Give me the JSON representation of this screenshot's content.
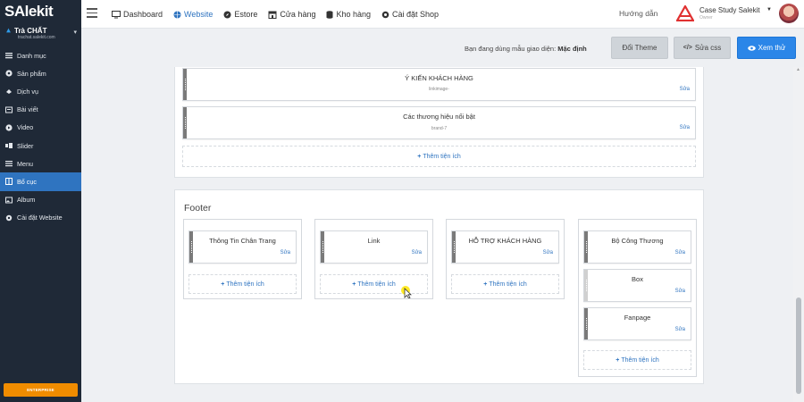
{
  "sidebar": {
    "logo": "SAlekit",
    "store_name": "Trà CHẤT",
    "store_url": "trachat.salekit.com",
    "items": [
      {
        "label": "Danh mục",
        "icon": "list-icon"
      },
      {
        "label": "Sản phẩm",
        "icon": "tag-icon"
      },
      {
        "label": "Dịch vụ",
        "icon": "service-icon"
      },
      {
        "label": "Bài viết",
        "icon": "article-icon"
      },
      {
        "label": "Video",
        "icon": "video-icon"
      },
      {
        "label": "Slider",
        "icon": "slider-icon"
      },
      {
        "label": "Menu",
        "icon": "menu-icon"
      },
      {
        "label": "Bố cục",
        "icon": "layout-icon",
        "active": true
      },
      {
        "label": "Album",
        "icon": "album-icon"
      },
      {
        "label": "Cài đặt Website",
        "icon": "gear-icon"
      }
    ],
    "enterprise_label": "ENTERPRISE"
  },
  "topbar": {
    "nav": [
      {
        "label": "Dashboard",
        "icon": "monitor-icon"
      },
      {
        "label": "Website",
        "icon": "globe-icon",
        "active": true
      },
      {
        "label": "Estore",
        "icon": "compass-icon"
      },
      {
        "label": "Cửa hàng",
        "icon": "store-icon"
      },
      {
        "label": "Kho hàng",
        "icon": "database-icon"
      },
      {
        "label": "Cài đặt Shop",
        "icon": "gear-icon"
      }
    ],
    "help": "Hướng dẫn",
    "user_name": "Case Study Salekit",
    "user_role": "Owner"
  },
  "themebar": {
    "text": "Bạn đang dùng mẫu giao diện:",
    "theme_name": "Mặc định",
    "change_theme": "Đổi Theme",
    "edit_css": "Sửa css",
    "preview": "Xem thử"
  },
  "content_section": {
    "widgets": [
      {
        "title": "Ý KIẾN KHÁCH HÀNG",
        "sub": "linkimage-",
        "edit": "Sửa"
      },
      {
        "title": "Các thương hiệu nổi bật",
        "sub": "brand-7",
        "edit": "Sửa"
      }
    ],
    "add_label": "Thêm tiện ích"
  },
  "footer": {
    "title": "Footer",
    "columns": [
      {
        "widgets": [
          {
            "title": "Thông Tin Chân Trang",
            "edit": "Sửa"
          }
        ],
        "add_label": "Thêm tiện ích"
      },
      {
        "widgets": [
          {
            "title": "Link",
            "edit": "Sửa"
          }
        ],
        "add_label": "Thêm tiện ích"
      },
      {
        "widgets": [
          {
            "title": "HỖ TRỢ KHÁCH HÀNG",
            "edit": "Sửa"
          }
        ],
        "add_label": "Thêm tiện ích"
      },
      {
        "widgets": [
          {
            "title": "Bộ Công Thương",
            "edit": "Sửa"
          },
          {
            "title": "Box",
            "edit": "Sửa"
          },
          {
            "title": "Fanpage",
            "edit": "Sửa"
          }
        ],
        "add_label": "Thêm tiện ích"
      }
    ]
  },
  "colors": {
    "sidebar_bg": "#1f2937",
    "active_blue": "#2f74c0",
    "primary_button": "#2b86e8",
    "enterprise": "#f08c00",
    "brand_red": "#e03131"
  }
}
